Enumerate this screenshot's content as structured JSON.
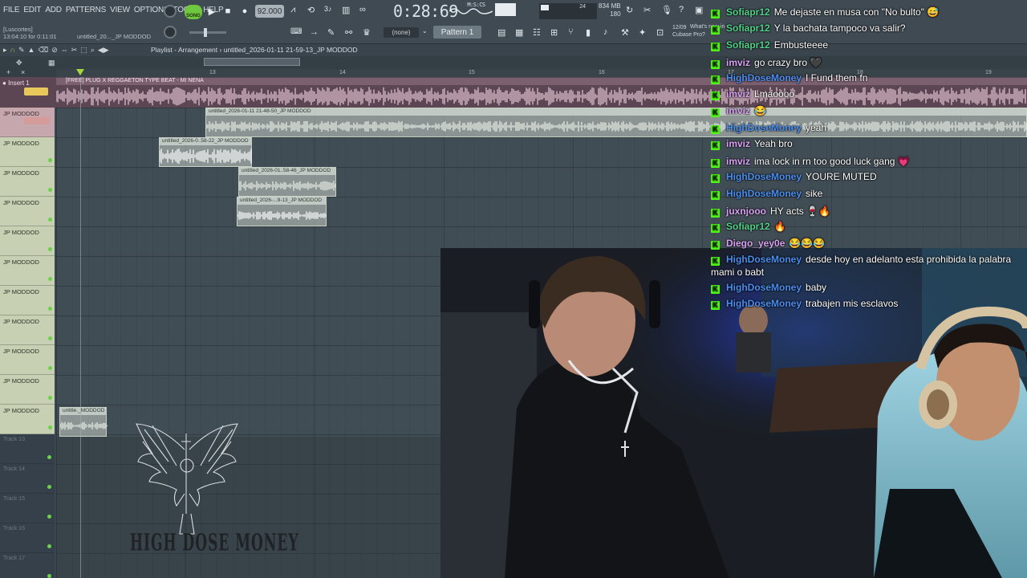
{
  "app": {
    "menu": [
      "FILE",
      "EDIT",
      "ADD",
      "PATTERNS",
      "VIEW",
      "OPTIONS",
      "TOOLS",
      "HELP"
    ],
    "song_mode_label": "SONG",
    "tempo": "92.000",
    "time_display": "0:28:69",
    "time_unit": "M:S:CS",
    "cpu_memory": "834 MB",
    "cpu_polyphony": "180",
    "cpu_value": "24",
    "pattern_selector": "Pattern 1",
    "snap_selector": "(none)",
    "hint_line1": "[Luscortes]",
    "hint_line2": "13:04:10 for 0:11:01",
    "hint_pattern": "untitled_20..._JP MODDOD",
    "news_date": "12/09",
    "news_line": "What's new in",
    "news_line2": "Cubase Pro?"
  },
  "playlist": {
    "title": "Playlist - Arrangement",
    "path": "untitled_2026-01-11 21-59-13_JP MODDOD",
    "ruler_marks": [
      "13",
      "14",
      "15",
      "16",
      "17",
      "18",
      "19"
    ],
    "insert_label": "Insert 1",
    "insert_clip_name": "[FREE] PLUG X REGGAETON TYPE BEAT - MI NENA",
    "first_track_label": "JP MODDOD",
    "track_labels": [
      "JP MODDOD",
      "JP MODDOD",
      "JP MODDOD",
      "JP MODDOD",
      "JP MODDOD",
      "JP MODDOD",
      "JP MODDOD",
      "JP MODDOD",
      "JP MODDOD",
      "JP MODDOD"
    ],
    "empty_tracks": [
      "Track 13",
      "Track 14",
      "Track 15",
      "Track 16",
      "Track 17"
    ],
    "clips": [
      {
        "name": "untitled_2026-01-11 21-48-50_JP MODDOD"
      },
      {
        "name": "untitled_2026-0..58-22_JP MODDOD"
      },
      {
        "name": "untitled_2026-01..58-46_JP MODDOD"
      },
      {
        "name": "untitled_2026-...9-13_JP MODDOD"
      },
      {
        "name": "untitle._MODDOD"
      }
    ]
  },
  "logo_text": "HIGH DOSE MONEY",
  "chat": [
    {
      "user": "Sofiapr12",
      "color": "#52d28a",
      "text": "Me dejaste en musa con \"No bulto\" 😅"
    },
    {
      "user": "Sofiapr12",
      "color": "#52d28a",
      "text": "Y la bachata tampoco va salir?"
    },
    {
      "user": "Sofiapr12",
      "color": "#52d28a",
      "text": "Embusteeee"
    },
    {
      "user": "imviz",
      "color": "#d9a3f5",
      "text": "go crazy bro 🖤"
    },
    {
      "user": "HighDoseMoney",
      "color": "#4a8ff0",
      "text": "I Fund them fn"
    },
    {
      "user": "imviz",
      "color": "#d9a3f5",
      "text": "Lmaoooo"
    },
    {
      "user": "imviz",
      "color": "#d9a3f5",
      "text": "😂"
    },
    {
      "user": "HighDoseMoney",
      "color": "#4a8ff0",
      "text": "yeah"
    },
    {
      "user": "imviz",
      "color": "#d9a3f5",
      "text": "Yeah bro"
    },
    {
      "user": "imviz",
      "color": "#d9a3f5",
      "text": "ima lock in rn too good luck gang 💗"
    },
    {
      "user": "HighDoseMoney",
      "color": "#4a8ff0",
      "text": "YOURE MUTED"
    },
    {
      "user": "HighDoseMoney",
      "color": "#4a8ff0",
      "text": "sike"
    },
    {
      "user": "juxnjooo",
      "color": "#d9a3f5",
      "text": "HY acts 🍷🔥"
    },
    {
      "user": "Sofiapr12",
      "color": "#52d28a",
      "text": "🔥"
    },
    {
      "user": "Diego_yey0e",
      "color": "#d9a3f5",
      "text": "😂😂😂"
    },
    {
      "user": "HighDoseMoney",
      "color": "#4a8ff0",
      "text": "desde hoy en adelanto esta prohibida la palabra"
    },
    {
      "user": "",
      "color": "#ffffff",
      "text": "mami o babt"
    },
    {
      "user": "HighDoseMoney",
      "color": "#4a8ff0",
      "text": "baby"
    },
    {
      "user": "HighDoseMoney",
      "color": "#4a8ff0",
      "text": "trabajen mis esclavos"
    }
  ],
  "colors": {
    "accent_green": "#6fc73f",
    "kick_badge": "#53fc18",
    "playlist_bg": "#414d55",
    "clip_pink": "#5c4654"
  }
}
